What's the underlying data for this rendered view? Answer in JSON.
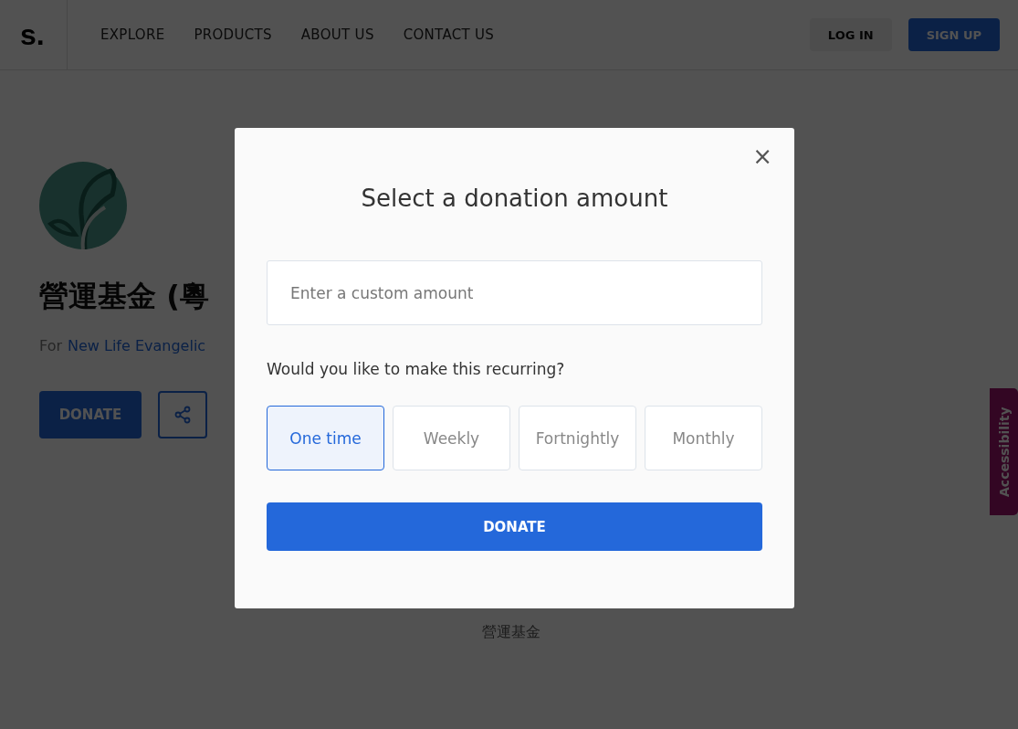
{
  "nav": {
    "logo": "s.",
    "links": [
      "EXPLORE",
      "PRODUCTS",
      "ABOUT US",
      "CONTACT US"
    ],
    "login": "LOG IN",
    "signup": "SIGN UP"
  },
  "campaign": {
    "title": "營運基金 (粵",
    "for_label": "For",
    "org_link": "New Life Evangelic",
    "donate": "DONATE",
    "footer_text": "營運基金"
  },
  "accessibility_tab": "Accessibility",
  "modal": {
    "close": "×",
    "title": "Select a donation amount",
    "amount_placeholder": "Enter a custom amount",
    "recurring_question": "Would you like to make this recurring?",
    "frequencies": [
      {
        "label": "One time",
        "selected": true
      },
      {
        "label": "Weekly",
        "selected": false
      },
      {
        "label": "Fortnightly",
        "selected": false
      },
      {
        "label": "Monthly",
        "selected": false
      }
    ],
    "donate": "DONATE"
  }
}
